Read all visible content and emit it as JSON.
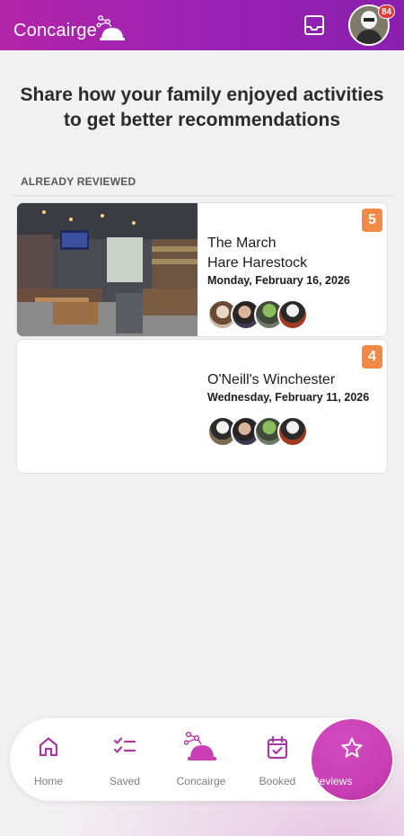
{
  "header": {
    "logo_text": "Concairge",
    "inbox_icon": "inbox-icon",
    "notification_count": "84",
    "brand_gradient": [
      "#b424a9",
      "#8a1fae"
    ]
  },
  "main": {
    "headline_line1": "Share how your family enjoyed activities",
    "headline_line2": "to get better recommendations",
    "section_label": "ALREADY REVIEWED"
  },
  "reviews": [
    {
      "title_line1": "The March",
      "title_line2": "Hare Harestock",
      "date": "Monday, February 16, 2026",
      "score": "5"
    },
    {
      "title_line1": "O'Neill's Winchester",
      "title_line2": "",
      "date": "Wednesday, February 11, 2026",
      "score": "4"
    }
  ],
  "colors": {
    "accent": "#c93fb4",
    "score_badge": "#f08a46",
    "notification_badge": "#e53b3b"
  },
  "nav": {
    "items": [
      {
        "label": "Home",
        "icon": "home-icon"
      },
      {
        "label": "Saved",
        "icon": "checklist-icon"
      },
      {
        "label": "Concairge",
        "icon": "concierge-bell-icon"
      },
      {
        "label": "Booked",
        "icon": "calendar-check-icon"
      },
      {
        "label": "Reviews",
        "icon": "star-icon"
      }
    ],
    "active": "Reviews"
  }
}
